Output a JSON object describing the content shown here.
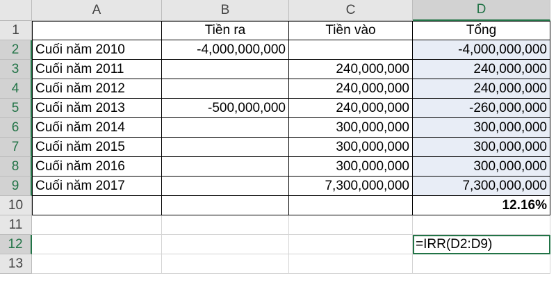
{
  "columns": [
    "A",
    "B",
    "C",
    "D"
  ],
  "rows": [
    "1",
    "2",
    "3",
    "4",
    "5",
    "6",
    "7",
    "8",
    "9",
    "10",
    "11",
    "12",
    "13"
  ],
  "header_row": {
    "a": "",
    "b": "Tiền ra",
    "c": "Tiền vào",
    "d": "Tổng"
  },
  "data_rows": [
    {
      "a": "Cuối năm 2010",
      "b": "-4,000,000,000",
      "c": "",
      "d": "-4,000,000,000"
    },
    {
      "a": "Cuối năm 2011",
      "b": "",
      "c": "240,000,000",
      "d": "240,000,000"
    },
    {
      "a": "Cuối năm 2012",
      "b": "",
      "c": "240,000,000",
      "d": "240,000,000"
    },
    {
      "a": "Cuối năm 2013",
      "b": "-500,000,000",
      "c": "240,000,000",
      "d": "-260,000,000"
    },
    {
      "a": "Cuối năm 2014",
      "b": "",
      "c": "300,000,000",
      "d": "300,000,000"
    },
    {
      "a": "Cuối năm 2015",
      "b": "",
      "c": "300,000,000",
      "d": "300,000,000"
    },
    {
      "a": "Cuối năm 2016",
      "b": "",
      "c": "300,000,000",
      "d": "300,000,000"
    },
    {
      "a": "Cuối năm 2017",
      "b": "",
      "c": "7,300,000,000",
      "d": "7,300,000,000"
    }
  ],
  "result_row": {
    "d": "12.16%"
  },
  "formula_cell": {
    "d": "=IRR(D2:D9)"
  },
  "colors": {
    "accent": "#217346",
    "selection_fill": "#e8edf6",
    "header_bg": "#e6e6e6"
  }
}
